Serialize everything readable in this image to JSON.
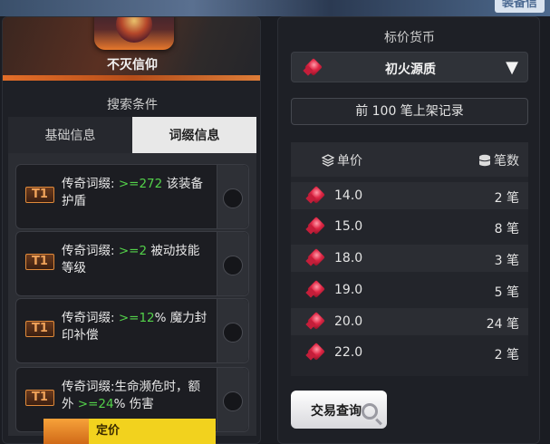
{
  "world": {
    "tag": "装备信"
  },
  "item": {
    "name": "不灭信仰"
  },
  "search": {
    "title": "搜索条件",
    "tabs": [
      {
        "label": "基础信息",
        "active": false
      },
      {
        "label": "词缀信息",
        "active": true
      }
    ]
  },
  "affixes": [
    {
      "tier": "T1",
      "prefix": "传奇词缀: ",
      "value": ">=272",
      "suffix": " 该装备护盾"
    },
    {
      "tier": "T1",
      "prefix": "传奇词缀: ",
      "value": ">=2",
      "suffix": " 被动技能等级"
    },
    {
      "tier": "T1",
      "prefix": "传奇词缀: ",
      "value": ">=12",
      "suffix": "% 魔力封印补偿"
    },
    {
      "tier": "T1",
      "prefix": "传奇词缀:生命濒危时，额外 ",
      "value": ">=24",
      "suffix": "% 伤害"
    }
  ],
  "price_tab": {
    "label": "定价"
  },
  "currency": {
    "title": "标价货币",
    "selected": "初火源质",
    "arrow": "▼"
  },
  "history": {
    "label": "前 100 笔上架记录"
  },
  "table": {
    "headers": {
      "price": "单价",
      "count": "笔数"
    },
    "rows": [
      {
        "price": "14.0",
        "count": "2 笔"
      },
      {
        "price": "15.0",
        "count": "8 笔"
      },
      {
        "price": "18.0",
        "count": "3 笔"
      },
      {
        "price": "19.0",
        "count": "5 笔"
      },
      {
        "price": "20.0",
        "count": "24 笔"
      },
      {
        "price": "22.0",
        "count": "2 笔"
      }
    ]
  },
  "trade": {
    "label": "交易查询"
  },
  "colors": {
    "highlight": "#53d14a",
    "accent": "#e8782c",
    "tab_active": "#e8e8e8"
  }
}
